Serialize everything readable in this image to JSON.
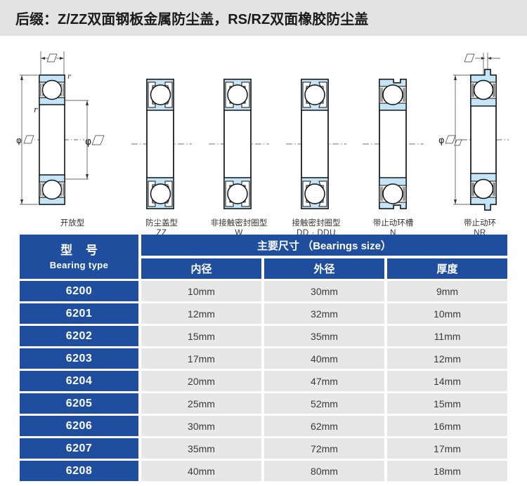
{
  "header": {
    "title": "后缀：Z/ZZ双面钢板金属防尘盖，RS/RZ双面橡胶防尘盖"
  },
  "diagrams": [
    {
      "id": "open-type",
      "caption_cn": "开放型",
      "caption_code": "",
      "dimension_labels": [
        "φ□",
        "φ□",
        "□",
        "r",
        "r"
      ]
    },
    {
      "id": "shielded-zz",
      "caption_cn": "防尘盖型",
      "caption_code": "ZZ"
    },
    {
      "id": "non-contact-seal-w",
      "caption_cn": "非接触密封圈型",
      "caption_code": "W"
    },
    {
      "id": "contact-seal-dd",
      "caption_cn": "接触密封圈型",
      "caption_code": "DD · DDU"
    },
    {
      "id": "snap-ring-groove-n",
      "caption_cn": "带止动环槽",
      "caption_code": "N"
    },
    {
      "id": "snap-ring-nr",
      "caption_cn": "带止动环",
      "caption_code": "NR",
      "dimension_labels": [
        "φ□",
        "□"
      ]
    }
  ],
  "table": {
    "header": {
      "type_cn": "型 号",
      "type_en": "Bearing  type",
      "size_group": "主要尺寸 （Bearings size）",
      "columns": [
        "内径",
        "外径",
        "厚度"
      ]
    },
    "rows": [
      {
        "type": "6200",
        "bore": "10mm",
        "outer": "30mm",
        "width": "9mm"
      },
      {
        "type": "6201",
        "bore": "12mm",
        "outer": "32mm",
        "width": "10mm"
      },
      {
        "type": "6202",
        "bore": "15mm",
        "outer": "35mm",
        "width": "11mm"
      },
      {
        "type": "6203",
        "bore": "17mm",
        "outer": "40mm",
        "width": "12mm"
      },
      {
        "type": "6204",
        "bore": "20mm",
        "outer": "47mm",
        "width": "14mm"
      },
      {
        "type": "6205",
        "bore": "25mm",
        "outer": "52mm",
        "width": "15mm"
      },
      {
        "type": "6206",
        "bore": "30mm",
        "outer": "62mm",
        "width": "16mm"
      },
      {
        "type": "6207",
        "bore": "35mm",
        "outer": "72mm",
        "width": "17mm"
      },
      {
        "type": "6208",
        "bore": "40mm",
        "outer": "80mm",
        "width": "18mm"
      }
    ]
  },
  "colors": {
    "header_band": "#e3e3e3",
    "table_blue": "#1f4e9e",
    "cell_grey": "#e7e7e7",
    "bearing_fill": "#c4e4f7",
    "line": "#1a1a1a"
  }
}
